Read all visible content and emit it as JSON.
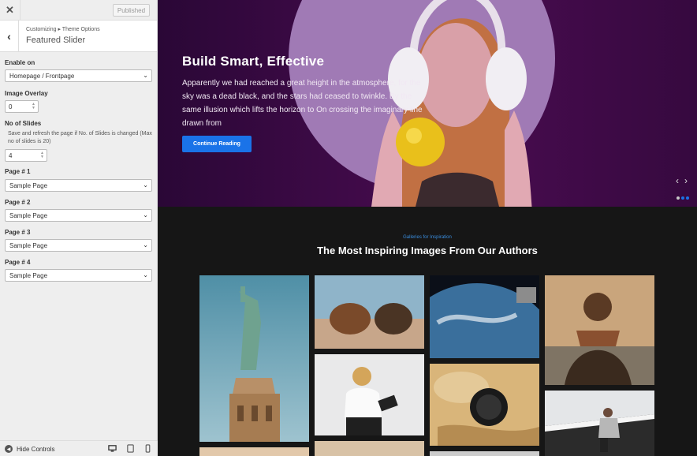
{
  "topbar": {
    "close_glyph": "✕",
    "published_label": "Published"
  },
  "header": {
    "back_glyph": "‹",
    "breadcrumb": "Customizing ▸ Theme Options",
    "title": "Featured Slider"
  },
  "controls": {
    "enable_on": {
      "label": "Enable on",
      "value": "Homepage / Frontpage"
    },
    "image_overlay": {
      "label": "Image Overlay",
      "value": "0"
    },
    "no_of_slides": {
      "label": "No of Slides",
      "description": "Save and refresh the page if No. of Slides is changed (Max no of slides is 20)",
      "value": "4"
    },
    "pages": [
      {
        "label": "Page # 1",
        "value": "Sample Page"
      },
      {
        "label": "Page # 2",
        "value": "Sample Page"
      },
      {
        "label": "Page # 3",
        "value": "Sample Page"
      },
      {
        "label": "Page # 4",
        "value": "Sample Page"
      }
    ]
  },
  "footer": {
    "hide_label": "Hide Controls",
    "devices": [
      "desktop-icon",
      "tablet-icon",
      "mobile-icon"
    ]
  },
  "hero": {
    "title": "Build Smart, Effective",
    "text": "Apparently we had reached a great height in the atmosphere, for the sky was a dead black, and the stars had ceased to twinkle. By the same illusion which lifts the horizon to On crossing the imaginary line drawn from",
    "cta_label": "Continue Reading",
    "prev_glyph": "‹",
    "next_glyph": "›",
    "active_slide": 1,
    "slide_count": 3
  },
  "gallery": {
    "eyebrow": "Galleries for Inspiration",
    "title": "The Most Inspiring Images From Our Authors"
  },
  "colors": {
    "accent": "#1a73e8",
    "hero_bg": "#4a0c51",
    "eyebrow": "#3a8dde"
  }
}
